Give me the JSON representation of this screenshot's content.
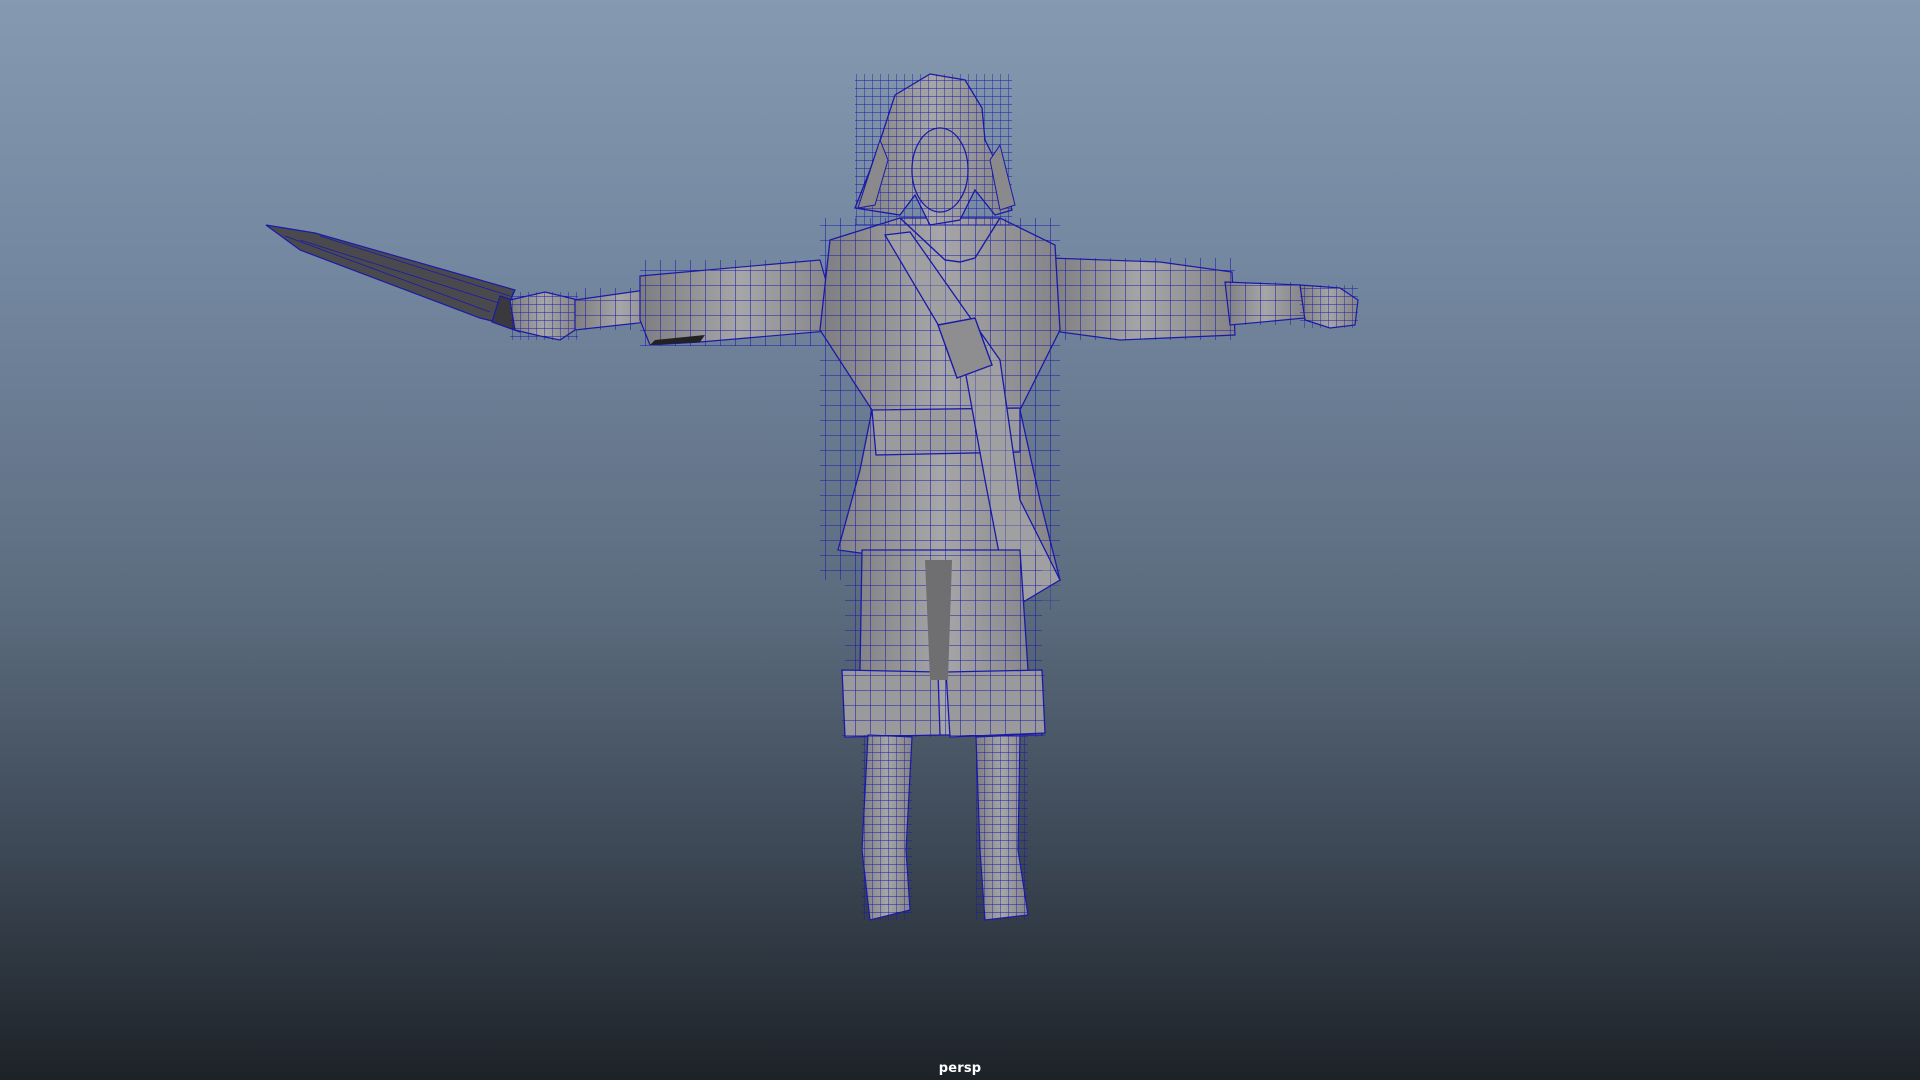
{
  "viewport": {
    "camera_name": "persp",
    "background_top": "#8599b0",
    "background_bottom": "#1d2228",
    "wireframe_color": "#1a1aa8",
    "mesh_color": "#9a9a9c",
    "subject_icon": "character-wireframe-mesh"
  }
}
